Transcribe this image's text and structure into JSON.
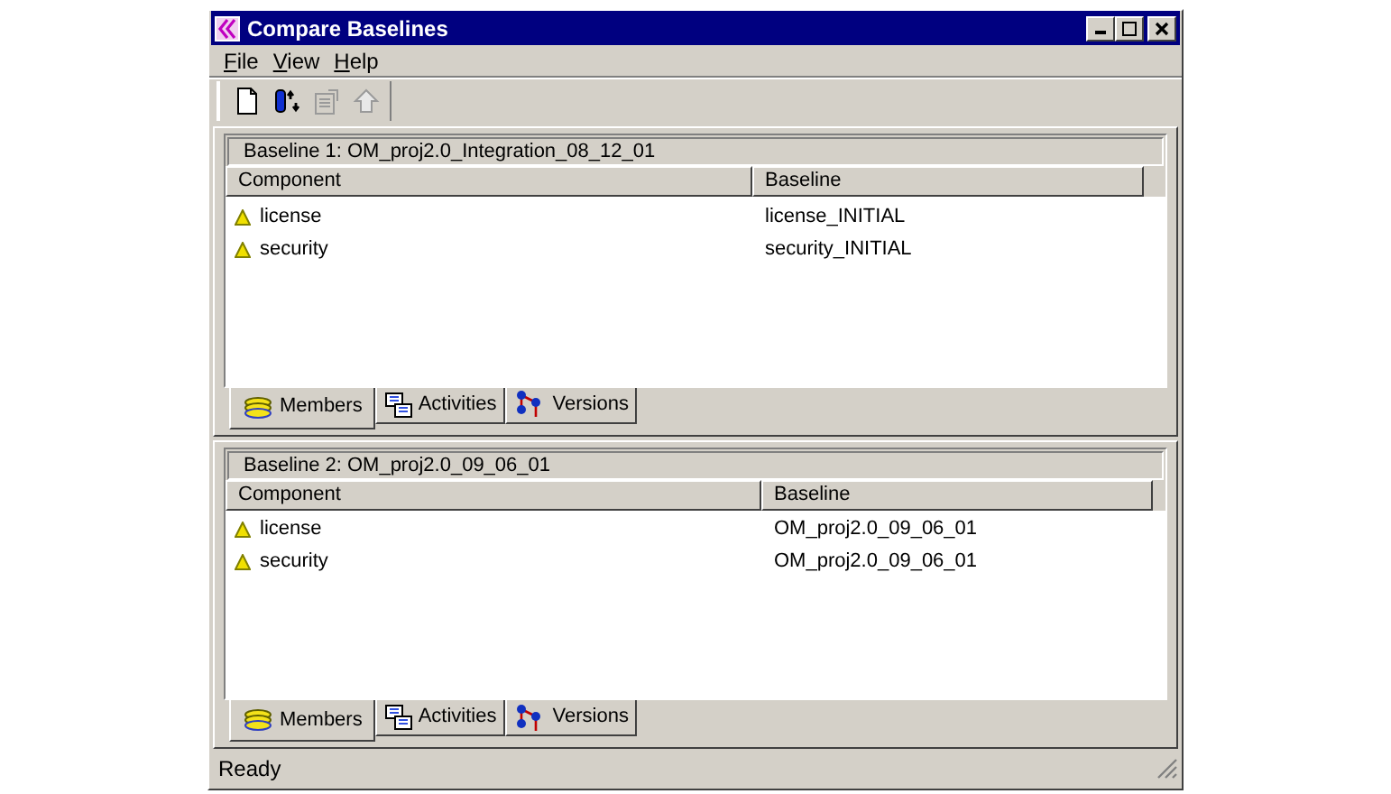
{
  "window": {
    "title": "Compare Baselines"
  },
  "menu": [
    "File",
    "View",
    "Help"
  ],
  "toolbar": [
    {
      "kind": "new",
      "disabled": false
    },
    {
      "kind": "compare",
      "disabled": false
    },
    {
      "kind": "properties",
      "disabled": true
    },
    {
      "kind": "up",
      "disabled": true
    }
  ],
  "panels": [
    {
      "title": "Baseline 1: OM_proj2.0_Integration_08_12_01",
      "columns": [
        "Component",
        "Baseline"
      ],
      "rows": [
        [
          "license",
          "license_INITIAL"
        ],
        [
          "security",
          "security_INITIAL"
        ]
      ],
      "tabs": [
        {
          "label": "Members",
          "kind": "members",
          "selected": true
        },
        {
          "label": "Activities",
          "kind": "activities",
          "selected": false
        },
        {
          "label": "Versions",
          "kind": "versions",
          "selected": false
        }
      ]
    },
    {
      "title": "Baseline 2: OM_proj2.0_09_06_01",
      "columns": [
        "Component",
        "Baseline"
      ],
      "rows": [
        [
          "license",
          "OM_proj2.0_09_06_01"
        ],
        [
          "security",
          "OM_proj2.0_09_06_01"
        ]
      ],
      "tabs": [
        {
          "label": "Members",
          "kind": "members",
          "selected": true
        },
        {
          "label": "Activities",
          "kind": "activities",
          "selected": false
        },
        {
          "label": "Versions",
          "kind": "versions",
          "selected": false
        }
      ]
    }
  ],
  "status_bar": "Ready"
}
